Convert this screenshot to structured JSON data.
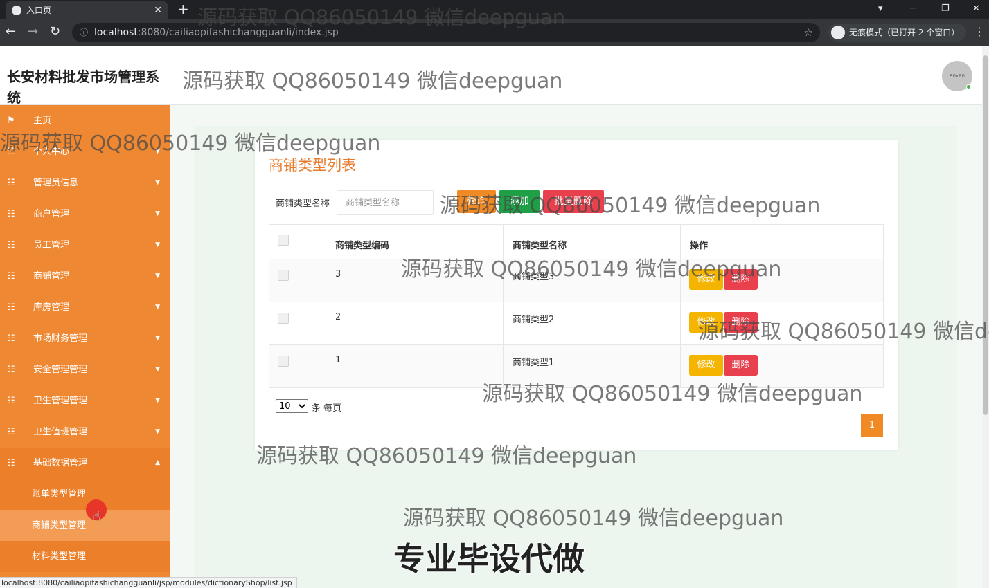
{
  "browser": {
    "tab_title": "入口页",
    "tab_close": "✕",
    "new_tab": "+",
    "url_host": "localhost",
    "url_path": ":8080/cailiaopifashichangguanli/index.jsp",
    "incognito_label": "无痕模式（已打开 2 个窗口）",
    "status_url": "localhost:8080/cailiaopifashichangguanli/jsp/modules/dictionaryShop/list.jsp"
  },
  "header": {
    "title": "长安材料批发市场管理系统",
    "avatar_text": "80x80"
  },
  "sidebar": {
    "items": [
      {
        "label": "主页",
        "icon": "flag-icon"
      },
      {
        "label": "个人中心",
        "icon": "grid-icon"
      },
      {
        "label": "管理员信息",
        "icon": "grid-icon"
      },
      {
        "label": "商户管理",
        "icon": "grid-icon"
      },
      {
        "label": "员工管理",
        "icon": "grid-icon"
      },
      {
        "label": "商铺管理",
        "icon": "grid-icon"
      },
      {
        "label": "库房管理",
        "icon": "grid-icon"
      },
      {
        "label": "市场财务管理",
        "icon": "grid-icon"
      },
      {
        "label": "安全管理管理",
        "icon": "grid-icon"
      },
      {
        "label": "卫生管理管理",
        "icon": "grid-icon"
      },
      {
        "label": "卫生值班管理",
        "icon": "grid-icon"
      },
      {
        "label": "基础数据管理",
        "icon": "grid-icon"
      }
    ],
    "subitems": [
      {
        "label": "账单类型管理"
      },
      {
        "label": "商铺类型管理"
      },
      {
        "label": "材料类型管理"
      }
    ]
  },
  "main": {
    "page_title": "商铺类型列表",
    "search_label": "商铺类型名称",
    "search_placeholder": "商铺类型名称",
    "search_button": "查询",
    "add_button": "添加",
    "batch_delete_button": "批量删除",
    "table": {
      "columns": [
        "商铺类型编码",
        "商铺类型名称",
        "操作"
      ],
      "rows": [
        {
          "code": "3",
          "name": "商铺类型3"
        },
        {
          "code": "2",
          "name": "商铺类型2"
        },
        {
          "code": "1",
          "name": "商铺类型1"
        }
      ],
      "edit_label": "修改",
      "delete_label": "删除"
    },
    "page_size": "10",
    "page_size_suffix": "条 每页",
    "current_page": "1"
  },
  "watermarks": {
    "text": "源码获取 QQ86050149 微信deepguan",
    "banner": "专业毕设代做"
  },
  "colors": {
    "sidebar": "#ef8833",
    "accent": "#e87a2b",
    "add": "#1fa047",
    "delete": "#e8414d",
    "edit": "#f5b400"
  }
}
